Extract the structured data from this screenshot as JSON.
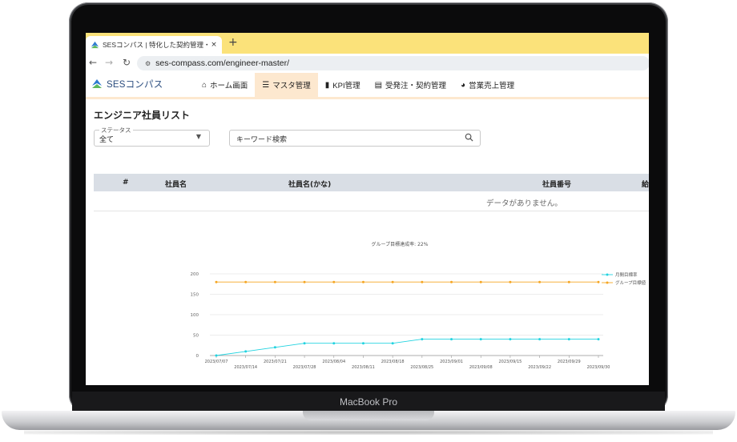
{
  "device": {
    "brand": "MacBook Pro"
  },
  "browser": {
    "tab_title": "SESコンパス | 特化した契約管理・案",
    "close_symbol": "×",
    "new_tab_symbol": "+",
    "url": "ses-compass.com/engineer-master/"
  },
  "app": {
    "logo_text": "SESコンパス",
    "menu": [
      {
        "label": "ホーム画面",
        "icon": "home-icon"
      },
      {
        "label": "マスタ管理",
        "icon": "database-icon",
        "active": true
      },
      {
        "label": "KPI管理",
        "icon": "bar-chart-icon"
      },
      {
        "label": "受発注・契約管理",
        "icon": "documents-icon"
      },
      {
        "label": "営業売上管理",
        "icon": "pie-chart-icon"
      }
    ]
  },
  "page": {
    "title": "エンジニア社員リスト",
    "status_label": "ステータス",
    "status_value": "全て",
    "search_placeholder": "キーワード検索"
  },
  "table": {
    "headers": [
      "#",
      "社員名",
      "社員名(かな)",
      "社員番号",
      "給"
    ],
    "empty_message": "データがありません。"
  },
  "colors": {
    "accent_tab": "#fbe27a",
    "active_menu": "#fde8cf",
    "series1": "#22d3e0",
    "series2": "#f5a623"
  },
  "chart_data": {
    "type": "line",
    "title": "グループ目標達成率: 22%",
    "x": [
      "2023/07/07",
      "2023/07/14",
      "2023/07/21",
      "2023/07/28",
      "2023/08/04",
      "2023/08/11",
      "2023/08/18",
      "2023/08/25",
      "2023/09/01",
      "2023/09/08",
      "2023/09/15",
      "2023/09/22",
      "2023/09/29",
      "2023/09/30"
    ],
    "yticks": [
      "200",
      "150",
      "100",
      "50",
      "0"
    ],
    "ylim": [
      0,
      200
    ],
    "series": [
      {
        "name": "月間目標率",
        "color": "#22d3e0",
        "values": [
          0,
          10,
          20,
          30,
          30,
          30,
          30,
          40,
          40,
          40,
          40,
          40,
          40,
          40
        ]
      },
      {
        "name": "グループ目標値",
        "color": "#f5a623",
        "values": [
          180,
          180,
          180,
          180,
          180,
          180,
          180,
          180,
          180,
          180,
          180,
          180,
          180,
          180
        ]
      }
    ],
    "legend_position": "right",
    "grid": true
  }
}
